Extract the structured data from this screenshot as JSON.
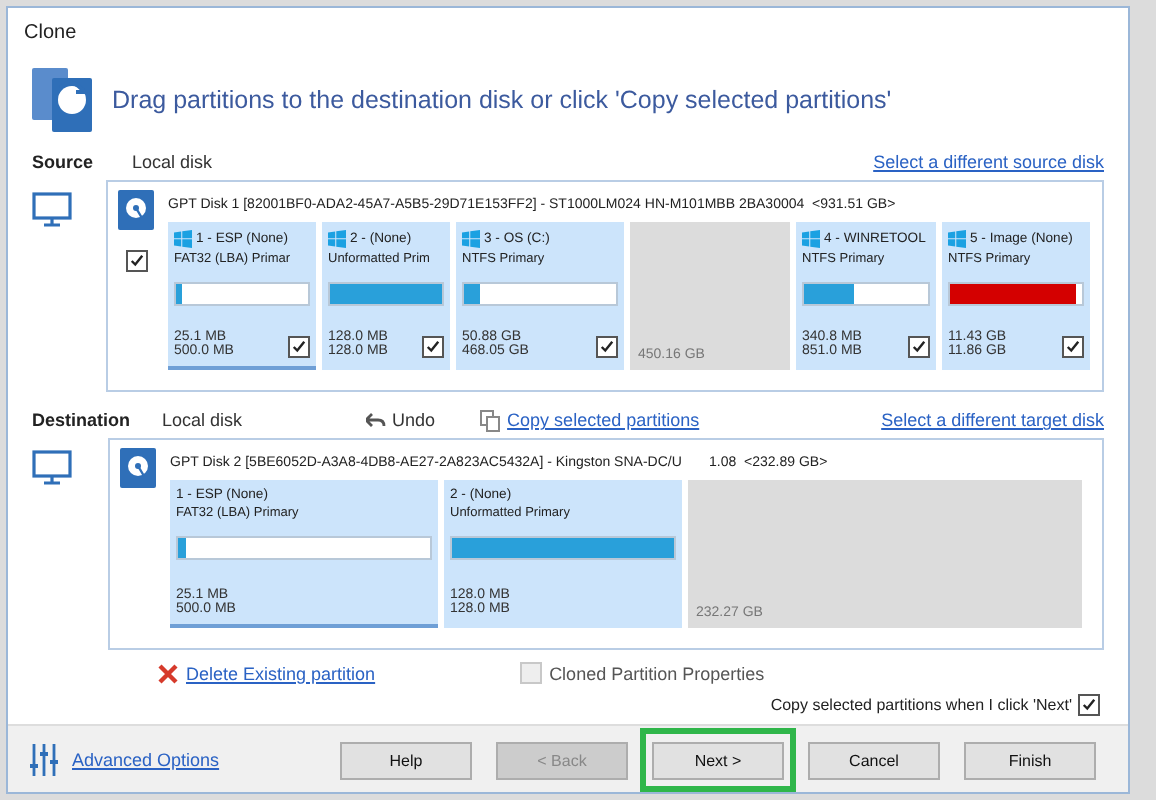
{
  "window": {
    "title": "Clone"
  },
  "header": {
    "text": "Drag partitions to the destination disk or click 'Copy selected partitions'"
  },
  "source": {
    "label": "Source",
    "type": "Local disk",
    "link": "Select a different source disk",
    "disk": {
      "title": "GPT Disk 1 [82001BF0-ADA2-45A7-A5B5-29D71E153FF2] - ST1000LM024 HN-M101MBB 2BA30004  <931.51 GB>",
      "checked": true,
      "partitions": [
        {
          "kind": "partition",
          "name": "1 - ESP (None)",
          "fs": "FAT32 (LBA) Primar",
          "level": 0.04,
          "used": "25.1 MB",
          "total": "500.0 MB",
          "checked": true,
          "selected": true,
          "color": "#29a0da"
        },
        {
          "kind": "partition",
          "name": "2 -  (None)",
          "fs": "Unformatted Prim",
          "level": 1,
          "used": "128.0 MB",
          "total": "128.0 MB",
          "checked": true,
          "selected": false,
          "color": "#29a0da"
        },
        {
          "kind": "partition",
          "name": "3 - OS (C:)",
          "fs": "NTFS Primary",
          "level": 0.11,
          "used": "50.88 GB",
          "total": "468.05 GB",
          "checked": true,
          "selected": false,
          "color": "#29a0da"
        },
        {
          "kind": "unallocated",
          "total": "450.16 GB"
        },
        {
          "kind": "partition",
          "name": "4 - WINRETOOL",
          "fs": "NTFS Primary",
          "level": 0.4,
          "used": "340.8 MB",
          "total": "851.0 MB",
          "checked": true,
          "selected": false,
          "color": "#29a0da"
        },
        {
          "kind": "partition",
          "name": "5 - Image (None)",
          "fs": "NTFS Primary",
          "level": 0.96,
          "used": "11.43 GB",
          "total": "11.86 GB",
          "checked": true,
          "selected": false,
          "color": "#d40000"
        }
      ]
    }
  },
  "destination": {
    "label": "Destination",
    "type": "Local disk",
    "undo": "Undo",
    "copy_link": "Copy selected partitions",
    "link": "Select a different target disk",
    "disk": {
      "title": "GPT Disk 2 [5BE6052D-A3A8-4DB8-AE27-2A823AC5432A] - Kingston SNA-DC/U       1.08  <232.89 GB>",
      "partitions": [
        {
          "kind": "partition",
          "name": "1 - ESP (None)",
          "fs": "FAT32 (LBA) Primary",
          "level": 0.03,
          "used": "25.1 MB",
          "total": "500.0 MB",
          "selected": true,
          "color": "#29a0da"
        },
        {
          "kind": "partition",
          "name": "2 -  (None)",
          "fs": "Unformatted Primary",
          "level": 1,
          "used": "128.0 MB",
          "total": "128.0 MB",
          "selected": false,
          "color": "#29a0da"
        },
        {
          "kind": "unallocated",
          "total": "232.27 GB"
        }
      ]
    }
  },
  "actions": {
    "delete": "Delete Existing partition",
    "properties": {
      "label": "Cloned Partition Properties",
      "disabled": true
    }
  },
  "copy_option": {
    "label": "Copy selected partitions when I click 'Next'",
    "checked": true
  },
  "footer": {
    "advanced": "Advanced Options",
    "buttons": [
      {
        "label": "Help",
        "disabled": false,
        "highlighted": false
      },
      {
        "label": "< Back",
        "disabled": true,
        "highlighted": false
      },
      {
        "label": "Next >",
        "disabled": false,
        "highlighted": true
      },
      {
        "label": "Cancel",
        "disabled": false,
        "highlighted": false
      },
      {
        "label": "Finish",
        "disabled": false,
        "highlighted": false
      }
    ]
  }
}
